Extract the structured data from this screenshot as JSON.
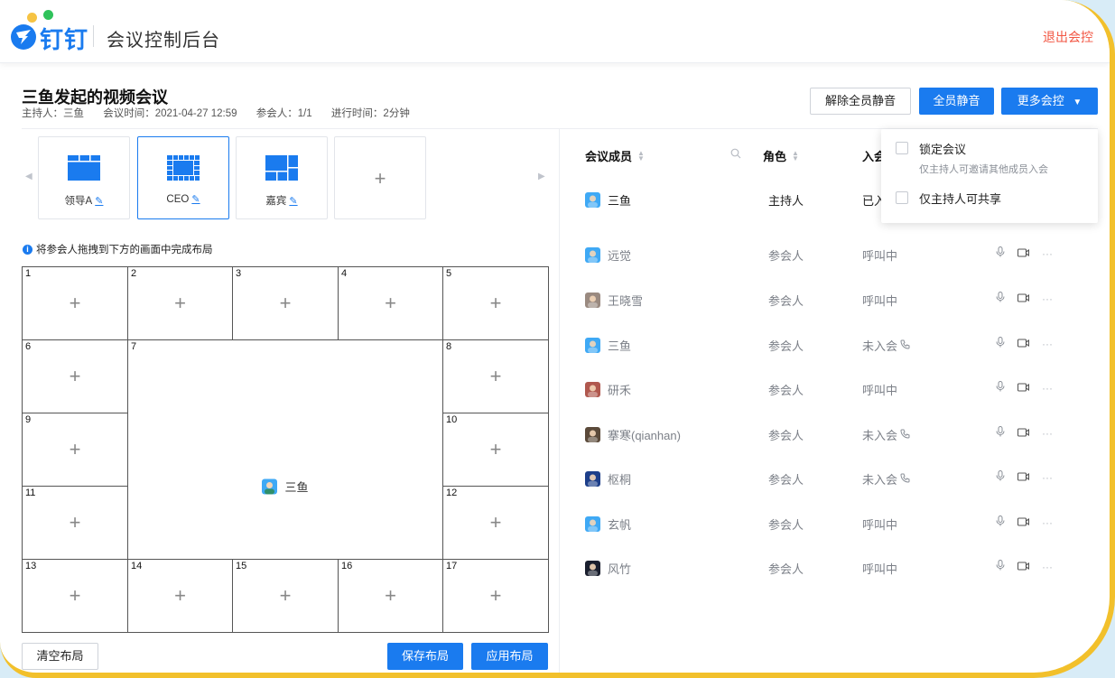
{
  "header": {
    "logo_text": "钉钉",
    "app_title": "会议控制后台",
    "exit_label": "退出会控"
  },
  "meeting": {
    "title": "三鱼发起的视频会议",
    "host": "主持人：三鱼",
    "time": "会议时间：2021-04-27 12:59",
    "participants": "参会人：1/1",
    "duration": "进行时间：2分钟"
  },
  "actions": {
    "unmute_all": "解除全员静音",
    "mute_all": "全员静音",
    "more_controls": "更多会控"
  },
  "layouts": {
    "cards": [
      {
        "label": "领导A",
        "icon": "layout-leader-icon"
      },
      {
        "label": "CEO",
        "icon": "layout-grid-icon",
        "selected": true
      },
      {
        "label": "嘉宾",
        "icon": "layout-guest-icon"
      }
    ],
    "add_label": "+",
    "hint": "将参会人拖拽到下方的画面中完成布局"
  },
  "grid": {
    "cells": [
      "1",
      "2",
      "3",
      "4",
      "5",
      "6",
      "7",
      "8",
      "9",
      "10",
      "11",
      "12",
      "13",
      "14",
      "15",
      "16",
      "17"
    ],
    "plus": "+",
    "main_user": "三鱼"
  },
  "bottom": {
    "clear": "清空布局",
    "save": "保存布局",
    "apply": "应用布局"
  },
  "members": {
    "headers": {
      "member": "会议成员",
      "role": "角色",
      "status": "入会"
    },
    "rows": [
      {
        "name": "三鱼",
        "role": "主持人",
        "status": "已入",
        "avatar": "#3fa9f5"
      },
      {
        "name": "远觉",
        "role": "参会人",
        "status": "呼叫中",
        "avatar": "#3fa9f5"
      },
      {
        "name": "王晓雪",
        "role": "参会人",
        "status": "呼叫中",
        "avatar": "#9a8a80"
      },
      {
        "name": "三鱼",
        "role": "参会人",
        "status": "未入会",
        "avatar": "#3fa9f5"
      },
      {
        "name": "研禾",
        "role": "参会人",
        "status": "呼叫中",
        "avatar": "#b0584e"
      },
      {
        "name": "搴寒(qianhan)",
        "role": "参会人",
        "status": "未入会",
        "avatar": "#5b4a3a"
      },
      {
        "name": "枢桐",
        "role": "参会人",
        "status": "未入会",
        "avatar": "#1d3f8a"
      },
      {
        "name": "玄帆",
        "role": "参会人",
        "status": "呼叫中",
        "avatar": "#3fa9f5"
      },
      {
        "name": "风竹",
        "role": "参会人",
        "status": "呼叫中",
        "avatar": "#1a1f2e"
      }
    ]
  },
  "dropdown": {
    "lock_label": "锁定会议",
    "lock_desc": "仅主持人可邀请其他成员入会",
    "share_label": "仅主持人可共享"
  },
  "colors": {
    "primary": "#1a7bef",
    "danger": "#f25643"
  }
}
